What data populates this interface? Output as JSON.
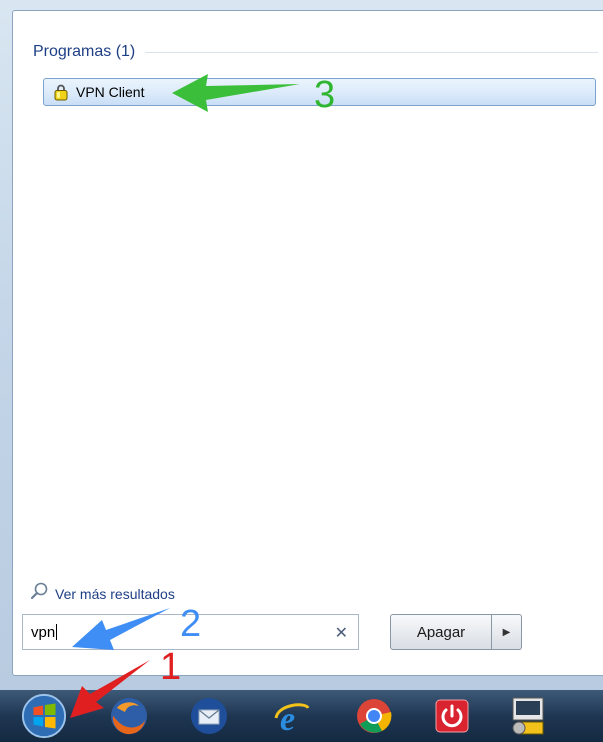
{
  "start_menu": {
    "section_title": "Programas (1)",
    "results": [
      {
        "label": "VPN Client",
        "icon": "vpn-client-lock-icon"
      }
    ],
    "see_more_label": "Ver más resultados",
    "search": {
      "value": "vpn",
      "clear_icon": "✕"
    },
    "shutdown": {
      "label": "Apagar",
      "arrow_icon": "▶"
    }
  },
  "taskbar": {
    "buttons": [
      {
        "name": "start-orb-button",
        "icon": "windows-logo-icon"
      },
      {
        "name": "firefox-button",
        "icon": "firefox-icon"
      },
      {
        "name": "thunderbird-button",
        "icon": "thunderbird-icon"
      },
      {
        "name": "internet-explorer-button",
        "icon": "internet-explorer-icon"
      },
      {
        "name": "chrome-button",
        "icon": "chrome-icon"
      },
      {
        "name": "power-app-button",
        "icon": "power-icon"
      },
      {
        "name": "network-app-button",
        "icon": "network-icon"
      }
    ]
  },
  "annotations": [
    {
      "label": "1",
      "color": "#e02020"
    },
    {
      "label": "2",
      "color": "#3f8ef5"
    },
    {
      "label": "3",
      "color": "#2fb52f"
    }
  ]
}
